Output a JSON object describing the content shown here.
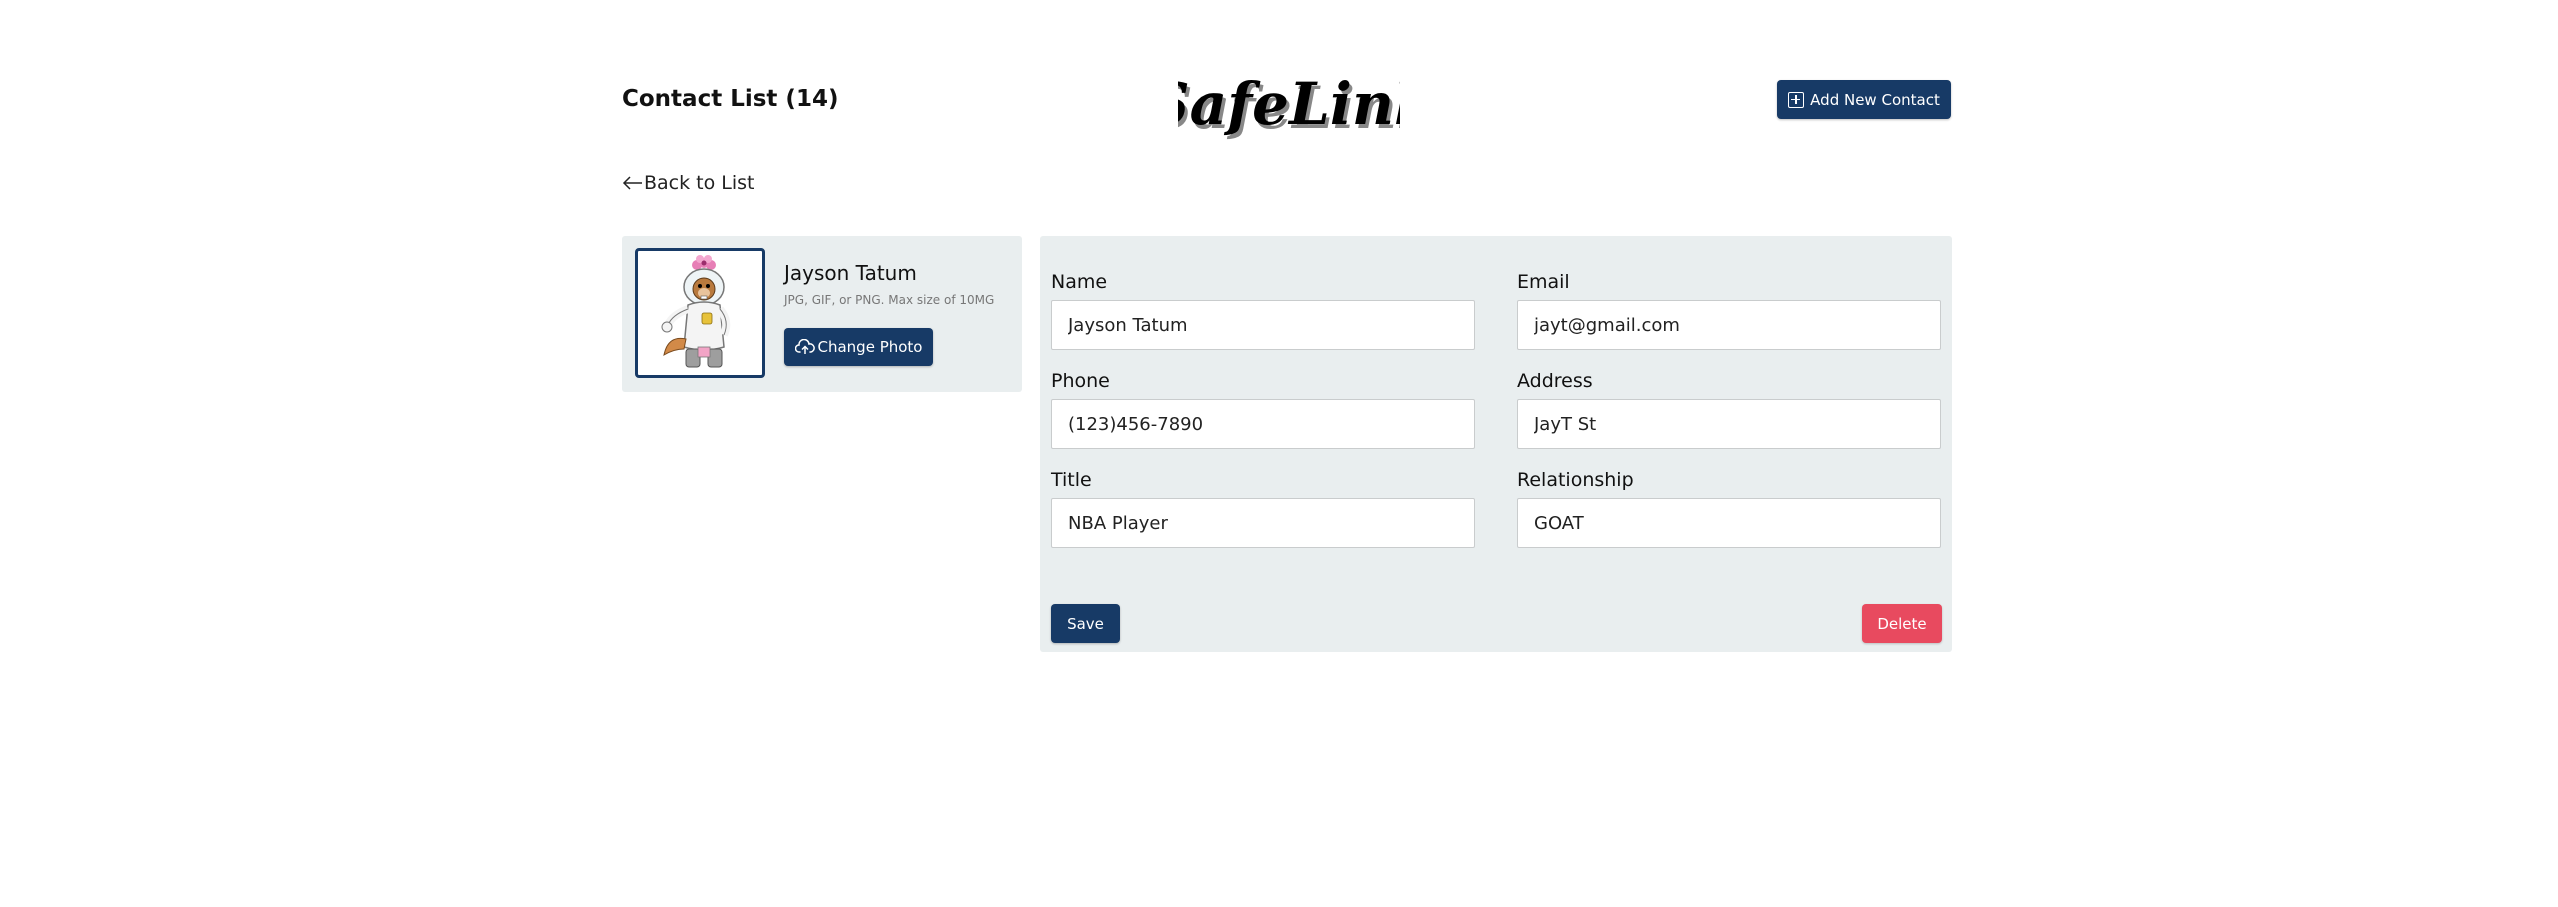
{
  "header": {
    "title": "Contact List (14)",
    "logo_text": "SafeLink",
    "add_contact_label": "Add New Contact"
  },
  "navigation": {
    "back_label": "Back to List"
  },
  "profile": {
    "name": "Jayson Tatum",
    "photo_hint": "JPG, GIF, or PNG. Max size of 10MG",
    "change_photo_label": "Change Photo"
  },
  "form": {
    "fields": [
      {
        "label": "Name",
        "value": "Jayson Tatum"
      },
      {
        "label": "Email",
        "value": "jayt@gmail.com"
      },
      {
        "label": "Phone",
        "value": "(123)456-7890"
      },
      {
        "label": "Address",
        "value": "JayT St"
      },
      {
        "label": "Title",
        "value": "NBA Player"
      },
      {
        "label": "Relationship",
        "value": "GOAT"
      }
    ],
    "save_label": "Save",
    "delete_label": "Delete"
  },
  "icons": {
    "add": "plus-square-icon",
    "back": "arrow-left-icon",
    "upload": "cloud-upload-icon"
  },
  "colors": {
    "primary": "#173a66",
    "danger": "#e84a5f",
    "panel": "#e9eeef"
  }
}
